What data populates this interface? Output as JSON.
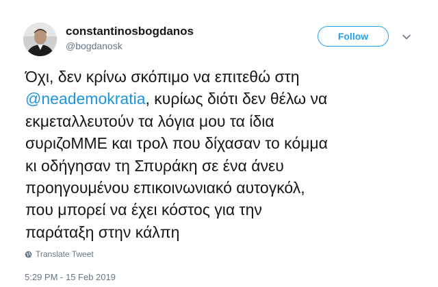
{
  "user": {
    "display_name": "constantinosbogdanos",
    "handle": "@bogdanosk"
  },
  "follow_label": "Follow",
  "tweet": {
    "line1": "Όχι, δεν κρίνω σκόπιμο να επιτεθώ στη",
    "mention": "@neademokratia",
    "line2_rest": ", κυρίως διότι δεν θέλω να",
    "line3": "εκμεταλλευτούν τα λόγια μου τα ίδια",
    "line4": "συριζοΜΜΕ και τρολ που δίχασαν το κόμμα",
    "line5": "κι οδήγησαν τη Σπυράκη σε ένα άνευ",
    "line6": "προηγουμένου επικοινωνιακό αυτογκόλ,",
    "line7": "που μπορεί να έχει κόστος για την",
    "line8": "παράταξη στην κάλπη"
  },
  "translate_label": "Translate Tweet",
  "timestamp": "5:29 PM - 15 Feb 2019",
  "icons": {
    "avatar": "profile-photo",
    "caret": "chevron-down-icon",
    "translate": "globe-icon"
  },
  "colors": {
    "accent": "#1da1f2",
    "mention": "#1b95e0",
    "muted": "#657786",
    "text": "#14171a"
  }
}
